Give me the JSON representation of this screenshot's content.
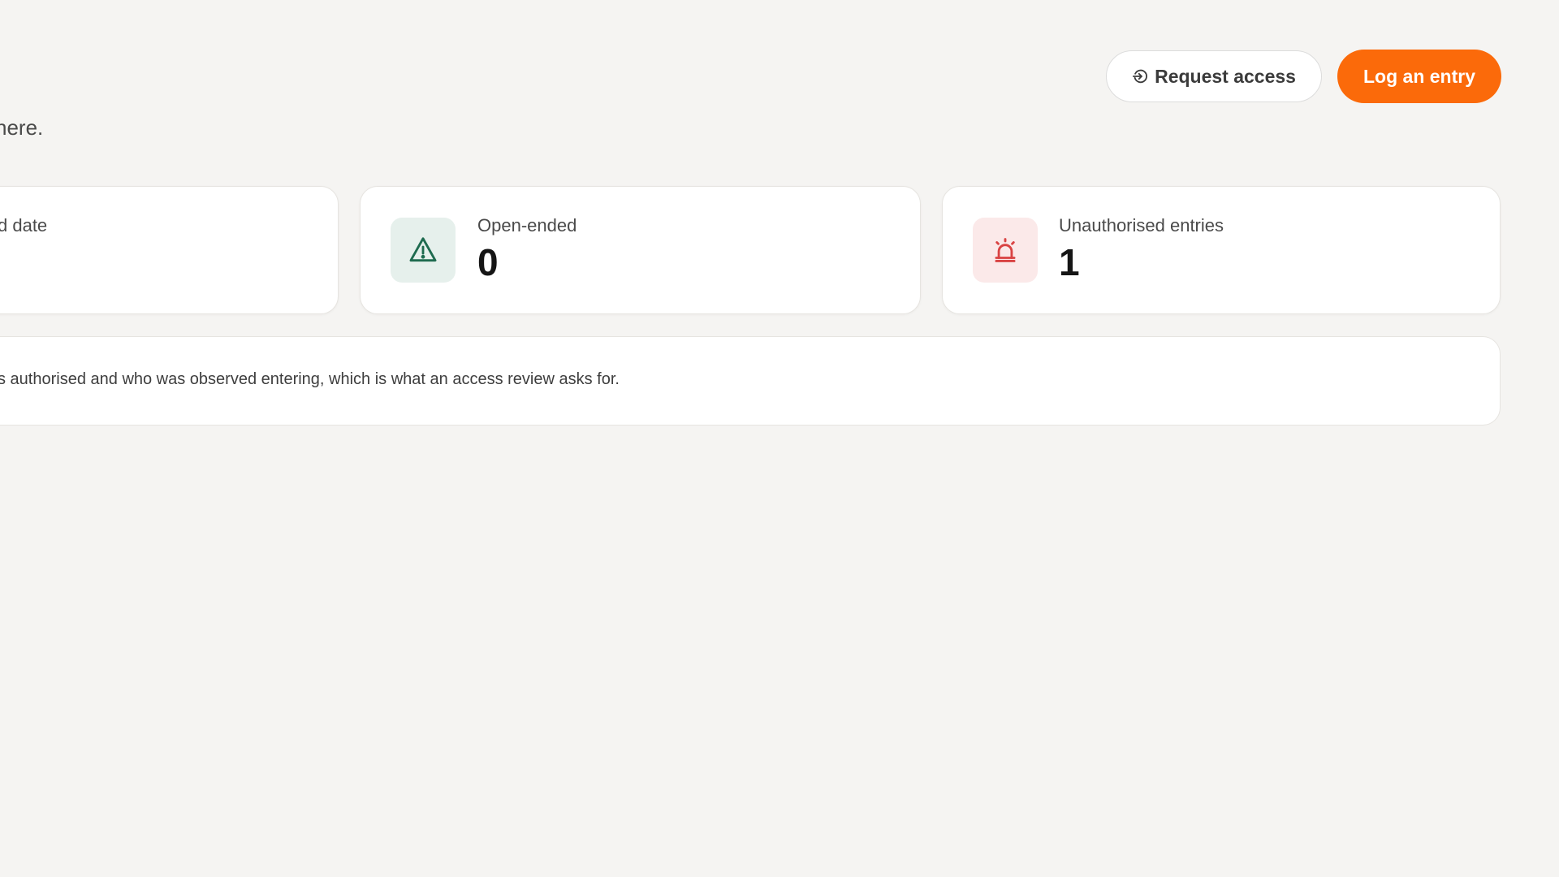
{
  "header": {
    "subtitle_fragment": "here.",
    "request_access_label": "Request access",
    "log_entry_label": "Log an entry"
  },
  "stats": {
    "card1": {
      "label": "d date"
    },
    "card2": {
      "label": "Open-ended",
      "value": "0",
      "icon": "warning-triangle-icon"
    },
    "card3": {
      "label": "Unauthorised entries",
      "value": "1",
      "icon": "siren-alarm-icon"
    }
  },
  "note": {
    "text": "s authorised and who was observed entering, which is what an access review asks for."
  },
  "colors": {
    "accent": "#fb6a0a",
    "green_icon": "#1e6b4f",
    "red_icon": "#d94343"
  }
}
